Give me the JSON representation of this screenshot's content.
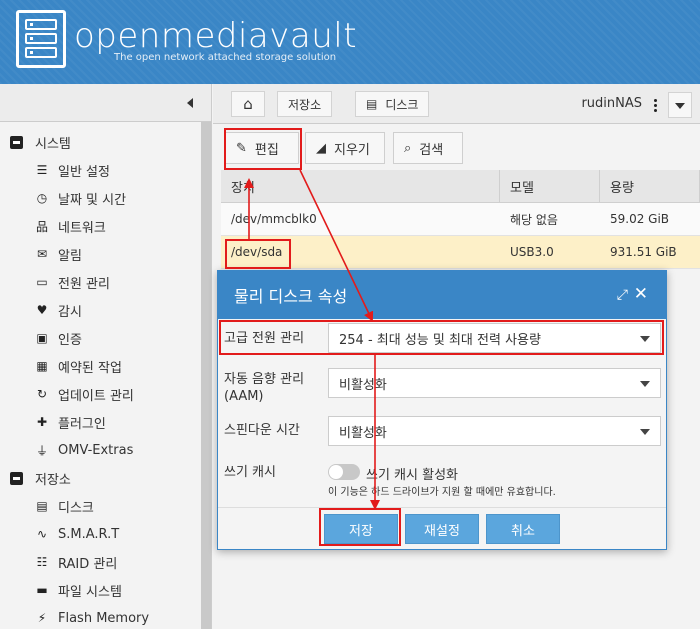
{
  "brand": {
    "name": "openmediavault",
    "tagline": "The open network attached storage solution"
  },
  "topbar": {
    "breadcrumbs": [
      "저장소",
      "디스크"
    ],
    "user": "rudinNAS"
  },
  "sidebar": {
    "groups": [
      {
        "label": "시스템",
        "items": [
          {
            "label": "일반 설정",
            "icon": "sliders-icon"
          },
          {
            "label": "날짜 및 시간",
            "icon": "clock-icon"
          },
          {
            "label": "네트워크",
            "icon": "network-icon"
          },
          {
            "label": "알림",
            "icon": "mail-icon"
          },
          {
            "label": "전원 관리",
            "icon": "battery-icon"
          },
          {
            "label": "감시",
            "icon": "heartbeat-icon"
          },
          {
            "label": "인증",
            "icon": "certificate-icon"
          },
          {
            "label": "예약된 작업",
            "icon": "calendar-icon"
          },
          {
            "label": "업데이트 관리",
            "icon": "refresh-icon"
          },
          {
            "label": "플러그인",
            "icon": "puzzle-icon"
          },
          {
            "label": "OMV-Extras",
            "icon": "plug-icon"
          }
        ]
      },
      {
        "label": "저장소",
        "items": [
          {
            "label": "디스크",
            "icon": "disk-icon"
          },
          {
            "label": "S.M.A.R.T",
            "icon": "pulse-icon"
          },
          {
            "label": "RAID 관리",
            "icon": "database-icon"
          },
          {
            "label": "파일 시스템",
            "icon": "folder-icon"
          },
          {
            "label": "Flash Memory",
            "icon": "bolt-icon"
          }
        ]
      }
    ]
  },
  "actions": {
    "edit": "편집",
    "wipe": "지우기",
    "search": "검색"
  },
  "grid": {
    "columns": [
      "장치",
      "모델",
      "용량"
    ],
    "rows": [
      [
        "/dev/mmcblk0",
        "해당 없음",
        "59.02 GiB"
      ],
      [
        "/dev/sda",
        "USB3.0",
        "931.51 GiB"
      ]
    ],
    "selected_row": 1
  },
  "dialog": {
    "title": "물리 디스크 속성",
    "fields": {
      "apm_label": "고급 전원 관리",
      "apm_value": "254 - 최대 성능 및 최대 전력 사용량",
      "aam_label": "자동 음향 관리\n(AAM)",
      "aam_label_1": "자동 음향 관리",
      "aam_label_2": "(AAM)",
      "aam_value": "비활성화",
      "spindown_label": "스핀다운 시간",
      "spindown_value": "비활성화",
      "cache_label": "쓰기 캐시",
      "cache_toggle_label": "쓰기 캐시 활성화",
      "cache_hint": "이 기능은 하드 드라이브가 지원 할 때에만 유효합니다."
    },
    "buttons": {
      "save": "저장",
      "reset": "재설정",
      "cancel": "취소"
    }
  },
  "colors": {
    "brand_blue": "#3a86c6",
    "button_blue": "#5ba6dd",
    "selected_row": "#fdf0c8",
    "annotation_red": "#e21b1b"
  }
}
